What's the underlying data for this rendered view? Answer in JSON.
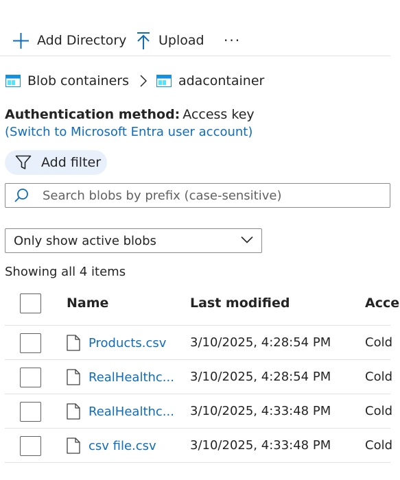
{
  "toolbar": {
    "add_directory_label": "Add Directory",
    "upload_label": "Upload",
    "more_label": "···"
  },
  "breadcrumb": {
    "items": [
      {
        "label": "Blob containers",
        "icon": "container-icon"
      },
      {
        "label": "adacontainer",
        "icon": "container-icon"
      }
    ]
  },
  "auth": {
    "label": "Authentication method:",
    "value": "Access key",
    "switch_link": "(Switch to Microsoft Entra user account)"
  },
  "filter": {
    "label": "Add filter"
  },
  "search": {
    "placeholder": "Search blobs by prefix (case-sensitive)",
    "value": ""
  },
  "dropdown": {
    "selected": "Only show active blobs"
  },
  "list": {
    "count_text": "Showing all 4 items",
    "columns": {
      "name": "Name",
      "modified": "Last modified",
      "access": "Acce"
    },
    "rows": [
      {
        "name": "Products.csv",
        "modified": "3/10/2025, 4:28:54 PM",
        "access": "Cold"
      },
      {
        "name": "RealHealthc...",
        "modified": "3/10/2025, 4:28:54 PM",
        "access": "Cold"
      },
      {
        "name": "RealHealthc...",
        "modified": "3/10/2025, 4:33:48 PM",
        "access": "Cold"
      },
      {
        "name": "csv file.csv",
        "modified": "3/10/2025, 4:33:48 PM",
        "access": "Cold"
      }
    ]
  },
  "colors": {
    "accent": "#0f6cbd",
    "pill_bg": "#e8f1fb",
    "text": "#242424",
    "border": "#8a8a8a"
  }
}
